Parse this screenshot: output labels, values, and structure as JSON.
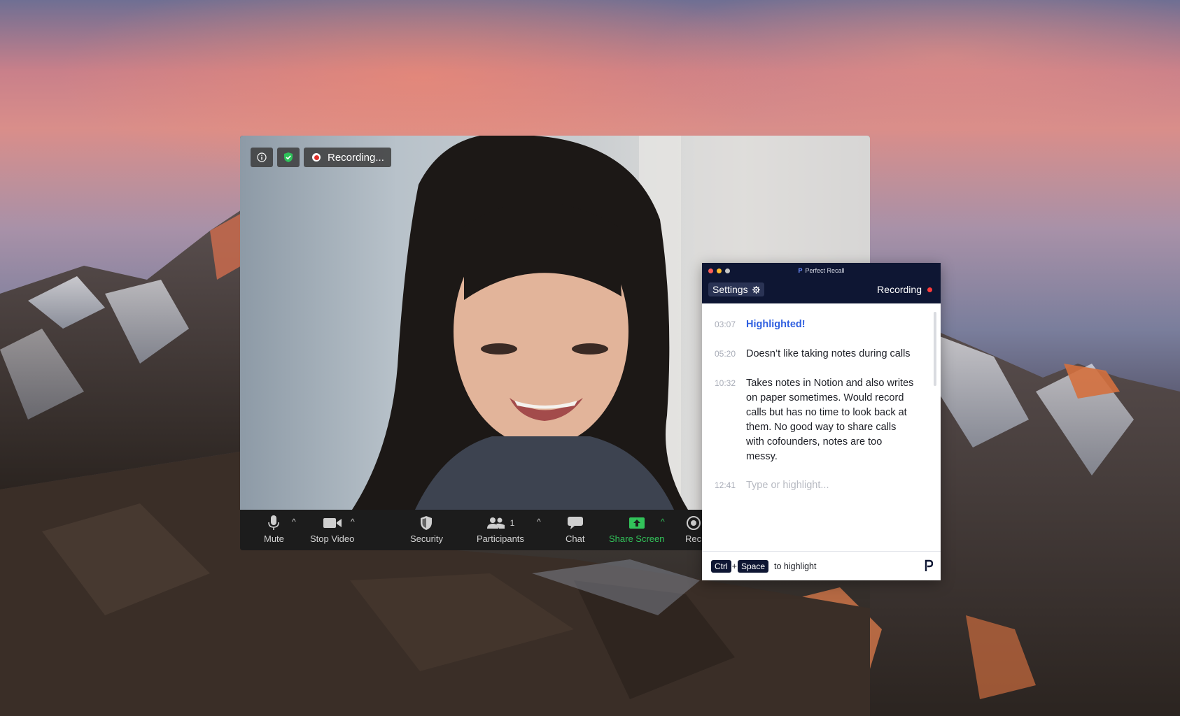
{
  "zoom": {
    "recording_badge": "Recording...",
    "toolbar": {
      "mute": "Mute",
      "stop_video": "Stop Video",
      "security": "Security",
      "participants": "Participants",
      "participants_count": "1",
      "chat": "Chat",
      "share_screen": "Share Screen",
      "record_partial": "Rec"
    },
    "colors": {
      "share_green": "#32c35a",
      "rec_red": "#e0302a"
    }
  },
  "perfect_recall": {
    "title": "Perfect Recall",
    "settings_label": "Settings",
    "recording_label": "Recording",
    "notes": [
      {
        "time": "03:07",
        "text": "Highlighted!",
        "style": "highlight"
      },
      {
        "time": "05:20",
        "text": "Doesn’t like taking notes during calls",
        "style": "normal"
      },
      {
        "time": "10:32",
        "text": "Takes notes in Notion and also writes on paper sometimes. Would record calls but has no time to look back at them. No good way to share calls with cofounders, notes are too messy.",
        "style": "normal"
      },
      {
        "time": "12:41",
        "text": "Type or highlight...",
        "style": "placeholder"
      }
    ],
    "footer": {
      "key1": "Ctrl",
      "plus": "+",
      "key2": "Space",
      "hint": "to highlight"
    },
    "colors": {
      "header_bg": "#0e1633",
      "highlight_blue": "#2f5fe0",
      "rec_dot": "#ff3b3b"
    }
  }
}
